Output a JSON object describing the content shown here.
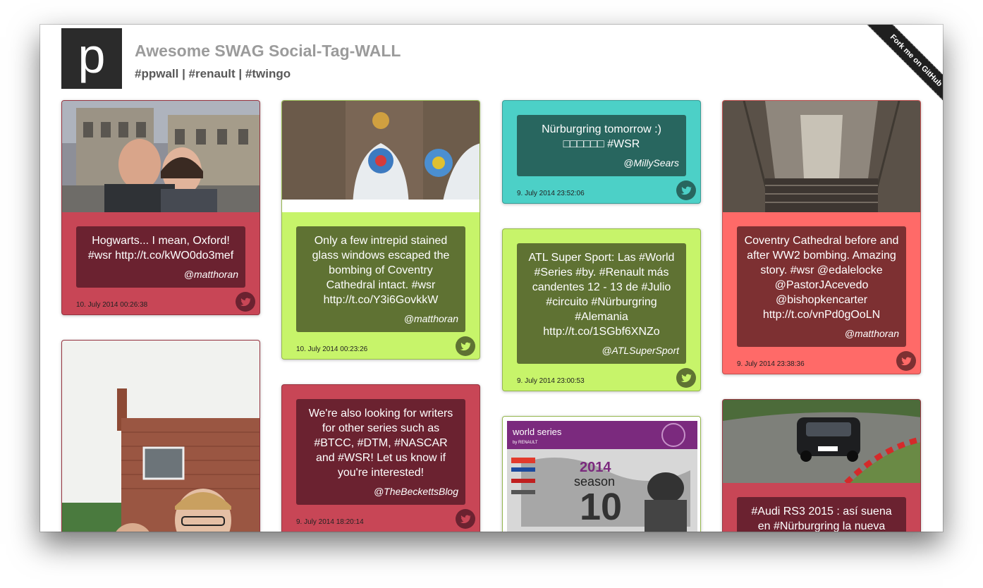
{
  "header": {
    "logo_letter": "p",
    "title": "Awesome SWAG Social-Tag-WALL",
    "tags": "#ppwall | #renault | #twingo",
    "ribbon": "Fork me on GitHub"
  },
  "colors": {
    "red": "#c84656",
    "green": "#c7f46a",
    "teal": "#4cd0c7",
    "salmon": "#ff6a68"
  },
  "cards": [
    {
      "text": "Hogwarts... I mean, Oxford! #wsr http://t.co/kWO0do3mef",
      "author": "@matthoran",
      "date": "10. July 2014 00:26:38",
      "icon": "twitter-icon"
    },
    {
      "text": "Only a few intrepid stained glass windows escaped the bombing of Coventry Cathedral intact. #wsr http://t.co/Y3i6GovkkW",
      "author": "@matthoran",
      "date": "10. July 2014 00:23:26",
      "icon": "twitter-icon"
    },
    {
      "text": "Nürburgring tomorrow :) □□□□□□ #WSR",
      "author": "@MillySears",
      "date": "9. July 2014 23:52:06",
      "icon": "twitter-icon"
    },
    {
      "text": "Coventry Cathedral before and after WW2 bombing. Amazing story. #wsr @edalelocke @PastorJAcevedo @bishopkencarter http://t.co/vnPd0gOoLN",
      "author": "@matthoran",
      "date": "9. July 2014 23:38:36",
      "icon": "twitter-icon"
    },
    {
      "text": "ATL Super Sport: Las #World #Series #by. #Renault más candentes 12 - 13 de #Julio #circuito #Nürburgring #Alemania http://t.co/1SGbf6XNZo",
      "author": "@ATLSuperSport",
      "date": "9. July 2014 23:00:53",
      "icon": "twitter-icon"
    },
    {
      "text": "We're also looking for writers for other series such as #BTCC, #DTM, #NASCAR and #WSR! Let us know if you're interested!",
      "author": "@TheBeckettsBlog",
      "date": "9. July 2014 18:20:14",
      "icon": "twitter-icon"
    },
    {
      "text": "#Audi RS3 2015 : así suena en #Nürburgring la nueva",
      "author": "",
      "date": "",
      "icon": "twitter-icon"
    }
  ],
  "poster": {
    "brand": "world series",
    "brand_sub": "by RENAULT",
    "year": "2014",
    "season": "season",
    "number": "10"
  }
}
